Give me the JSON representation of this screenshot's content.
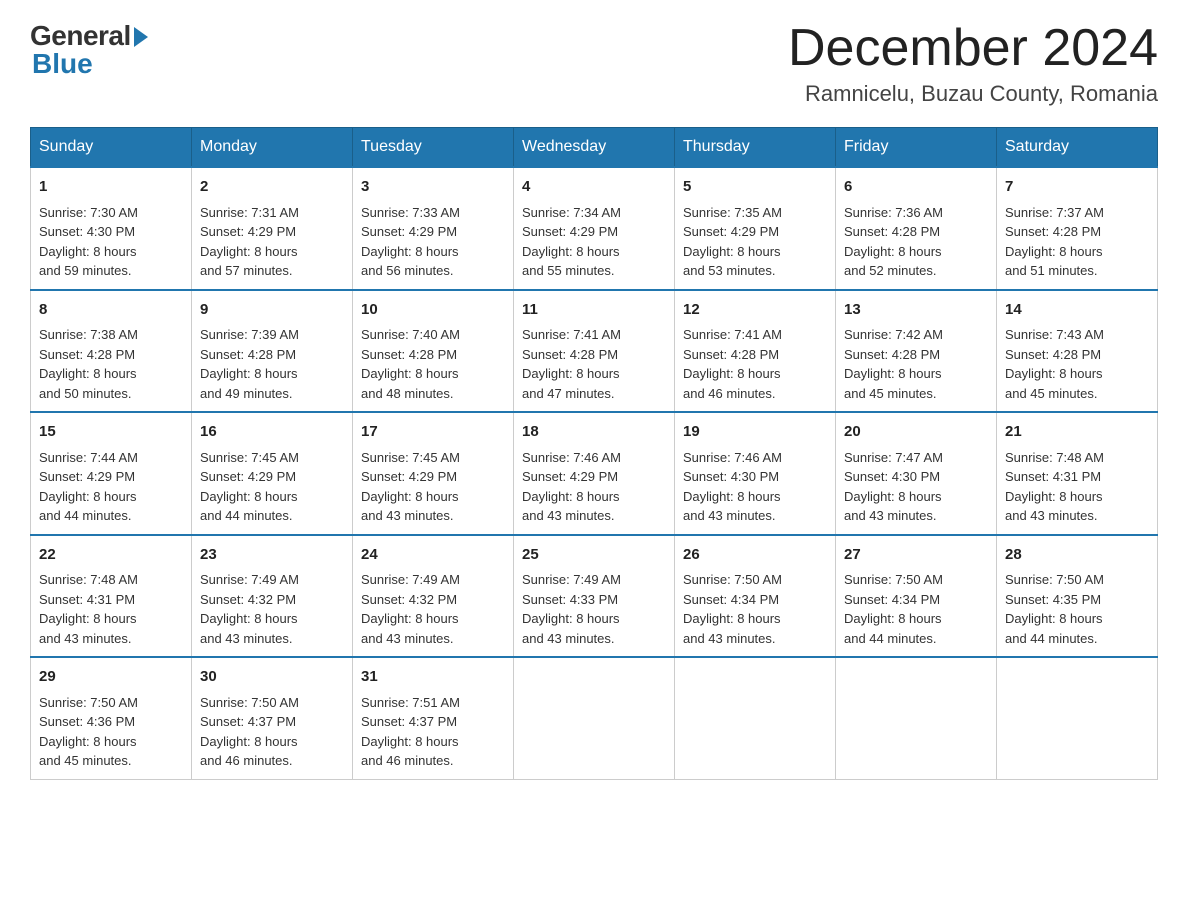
{
  "header": {
    "logo_general": "General",
    "logo_blue": "Blue",
    "month_title": "December 2024",
    "location": "Ramnicelu, Buzau County, Romania"
  },
  "days_of_week": [
    "Sunday",
    "Monday",
    "Tuesday",
    "Wednesday",
    "Thursday",
    "Friday",
    "Saturday"
  ],
  "weeks": [
    [
      {
        "day": "1",
        "sunrise": "7:30 AM",
        "sunset": "4:30 PM",
        "daylight": "8 hours and 59 minutes."
      },
      {
        "day": "2",
        "sunrise": "7:31 AM",
        "sunset": "4:29 PM",
        "daylight": "8 hours and 57 minutes."
      },
      {
        "day": "3",
        "sunrise": "7:33 AM",
        "sunset": "4:29 PM",
        "daylight": "8 hours and 56 minutes."
      },
      {
        "day": "4",
        "sunrise": "7:34 AM",
        "sunset": "4:29 PM",
        "daylight": "8 hours and 55 minutes."
      },
      {
        "day": "5",
        "sunrise": "7:35 AM",
        "sunset": "4:29 PM",
        "daylight": "8 hours and 53 minutes."
      },
      {
        "day": "6",
        "sunrise": "7:36 AM",
        "sunset": "4:28 PM",
        "daylight": "8 hours and 52 minutes."
      },
      {
        "day": "7",
        "sunrise": "7:37 AM",
        "sunset": "4:28 PM",
        "daylight": "8 hours and 51 minutes."
      }
    ],
    [
      {
        "day": "8",
        "sunrise": "7:38 AM",
        "sunset": "4:28 PM",
        "daylight": "8 hours and 50 minutes."
      },
      {
        "day": "9",
        "sunrise": "7:39 AM",
        "sunset": "4:28 PM",
        "daylight": "8 hours and 49 minutes."
      },
      {
        "day": "10",
        "sunrise": "7:40 AM",
        "sunset": "4:28 PM",
        "daylight": "8 hours and 48 minutes."
      },
      {
        "day": "11",
        "sunrise": "7:41 AM",
        "sunset": "4:28 PM",
        "daylight": "8 hours and 47 minutes."
      },
      {
        "day": "12",
        "sunrise": "7:41 AM",
        "sunset": "4:28 PM",
        "daylight": "8 hours and 46 minutes."
      },
      {
        "day": "13",
        "sunrise": "7:42 AM",
        "sunset": "4:28 PM",
        "daylight": "8 hours and 45 minutes."
      },
      {
        "day": "14",
        "sunrise": "7:43 AM",
        "sunset": "4:28 PM",
        "daylight": "8 hours and 45 minutes."
      }
    ],
    [
      {
        "day": "15",
        "sunrise": "7:44 AM",
        "sunset": "4:29 PM",
        "daylight": "8 hours and 44 minutes."
      },
      {
        "day": "16",
        "sunrise": "7:45 AM",
        "sunset": "4:29 PM",
        "daylight": "8 hours and 44 minutes."
      },
      {
        "day": "17",
        "sunrise": "7:45 AM",
        "sunset": "4:29 PM",
        "daylight": "8 hours and 43 minutes."
      },
      {
        "day": "18",
        "sunrise": "7:46 AM",
        "sunset": "4:29 PM",
        "daylight": "8 hours and 43 minutes."
      },
      {
        "day": "19",
        "sunrise": "7:46 AM",
        "sunset": "4:30 PM",
        "daylight": "8 hours and 43 minutes."
      },
      {
        "day": "20",
        "sunrise": "7:47 AM",
        "sunset": "4:30 PM",
        "daylight": "8 hours and 43 minutes."
      },
      {
        "day": "21",
        "sunrise": "7:48 AM",
        "sunset": "4:31 PM",
        "daylight": "8 hours and 43 minutes."
      }
    ],
    [
      {
        "day": "22",
        "sunrise": "7:48 AM",
        "sunset": "4:31 PM",
        "daylight": "8 hours and 43 minutes."
      },
      {
        "day": "23",
        "sunrise": "7:49 AM",
        "sunset": "4:32 PM",
        "daylight": "8 hours and 43 minutes."
      },
      {
        "day": "24",
        "sunrise": "7:49 AM",
        "sunset": "4:32 PM",
        "daylight": "8 hours and 43 minutes."
      },
      {
        "day": "25",
        "sunrise": "7:49 AM",
        "sunset": "4:33 PM",
        "daylight": "8 hours and 43 minutes."
      },
      {
        "day": "26",
        "sunrise": "7:50 AM",
        "sunset": "4:34 PM",
        "daylight": "8 hours and 43 minutes."
      },
      {
        "day": "27",
        "sunrise": "7:50 AM",
        "sunset": "4:34 PM",
        "daylight": "8 hours and 44 minutes."
      },
      {
        "day": "28",
        "sunrise": "7:50 AM",
        "sunset": "4:35 PM",
        "daylight": "8 hours and 44 minutes."
      }
    ],
    [
      {
        "day": "29",
        "sunrise": "7:50 AM",
        "sunset": "4:36 PM",
        "daylight": "8 hours and 45 minutes."
      },
      {
        "day": "30",
        "sunrise": "7:50 AM",
        "sunset": "4:37 PM",
        "daylight": "8 hours and 46 minutes."
      },
      {
        "day": "31",
        "sunrise": "7:51 AM",
        "sunset": "4:37 PM",
        "daylight": "8 hours and 46 minutes."
      },
      null,
      null,
      null,
      null
    ]
  ],
  "labels": {
    "sunrise": "Sunrise: ",
    "sunset": "Sunset: ",
    "daylight": "Daylight: "
  }
}
